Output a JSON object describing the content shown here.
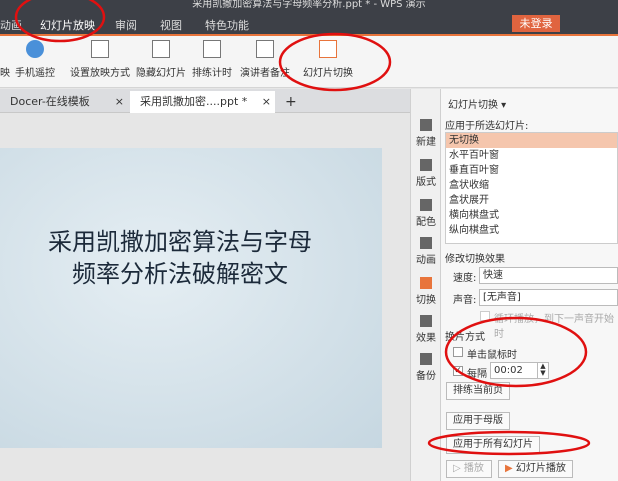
{
  "window": {
    "title": "采用凯撒加密算法与字母频率分析.ppt * - WPS 演示"
  },
  "menu": [
    "动画",
    "幻灯片放映",
    "审阅",
    "视图",
    "特色功能"
  ],
  "login": "未登录",
  "ribbon": [
    "映",
    "手机遥控",
    "设置放映方式",
    "隐藏幻灯片",
    "排练计时",
    "演讲者备注",
    "幻灯片切换"
  ],
  "tabs": [
    {
      "label": "Docer-在线模板"
    },
    {
      "label": "采用凯撒加密....ppt *"
    }
  ],
  "new_tab": "+",
  "slide": {
    "title_line1": "采用凯撒加密算法与字母",
    "title_line2": "频率分析法破解密文"
  },
  "side_strip": [
    "新建",
    "版式",
    "配色",
    "动画",
    "切换",
    "效果",
    "备份"
  ],
  "panel": {
    "title": "幻灯片切换 ▾",
    "apply_label": "应用于所选幻灯片:",
    "transitions": [
      "无切换",
      "水平百叶窗",
      "垂直百叶窗",
      "盒状收缩",
      "盒状展开",
      "横向棋盘式",
      "纵向棋盘式"
    ],
    "selected": "无切换",
    "modify_label": "修改切换效果",
    "speed_label": "速度:",
    "speed_value": "快速",
    "sound_label": "声音:",
    "sound_value": "[无声音]",
    "loop_label": "循环播放，到下一声音开始时",
    "advance_label": "换片方式",
    "on_click_label": "单击鼠标时",
    "on_click_checked": false,
    "every_label": "每隔",
    "every_checked": true,
    "every_value": "00:02",
    "rehearse_btn": "排练当前页",
    "apply_master_btn": "应用于母版",
    "apply_all_btn": "应用于所有幻灯片",
    "play_btn": "播放",
    "slideshow_btn": "幻灯片播放"
  },
  "colors": {
    "accent": "#e8743b",
    "annotation": "#e01010",
    "selected": "#f5c6ad"
  }
}
